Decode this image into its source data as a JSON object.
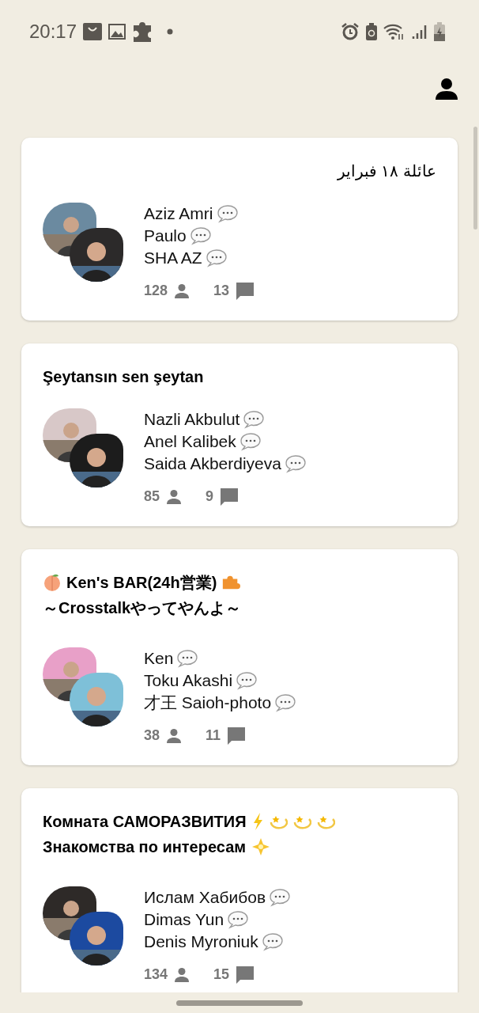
{
  "status_bar": {
    "time": "20:17"
  },
  "rooms": [
    {
      "title": [
        {
          "kind": "text",
          "text": "عائلة ١٨ فبراير"
        }
      ],
      "members": [
        {
          "name": "Aziz Amri"
        },
        {
          "name": "Paulo"
        },
        {
          "name": "SHA AZ"
        }
      ],
      "listeners": "128",
      "messages": "13"
    },
    {
      "title": [
        {
          "kind": "text",
          "text": "Şeytansın sen şeytan"
        }
      ],
      "members": [
        {
          "name": "Nazli Akbulut"
        },
        {
          "name": "Anel Kalibek"
        },
        {
          "name": "Saida Akberdiyeva"
        }
      ],
      "listeners": "85",
      "messages": "9"
    },
    {
      "title": [
        {
          "kind": "peach"
        },
        {
          "kind": "text",
          "text": "Ken's BAR(24h営業)"
        },
        {
          "kind": "puzzle"
        },
        {
          "kind": "text",
          "text": "～Crosstalkやってやんよ～"
        }
      ],
      "members": [
        {
          "name": "Ken"
        },
        {
          "name": "Toku Akashi"
        },
        {
          "name": "才王 Saioh-photo"
        }
      ],
      "listeners": "38",
      "messages": "11"
    },
    {
      "title": [
        {
          "kind": "text",
          "text": "Комната САМОРАЗВИТИЯ"
        },
        {
          "kind": "bolt"
        },
        {
          "kind": "dizzy"
        },
        {
          "kind": "dizzy"
        },
        {
          "kind": "dizzy"
        },
        {
          "kind": "text",
          "text": "Знакомства по интересам"
        },
        {
          "kind": "sparkle"
        }
      ],
      "members": [
        {
          "name": "Ислам Хабибов"
        },
        {
          "name": "Dimas Yun"
        },
        {
          "name": "Denis Myroniuk"
        }
      ],
      "listeners": "134",
      "messages": "15"
    }
  ]
}
